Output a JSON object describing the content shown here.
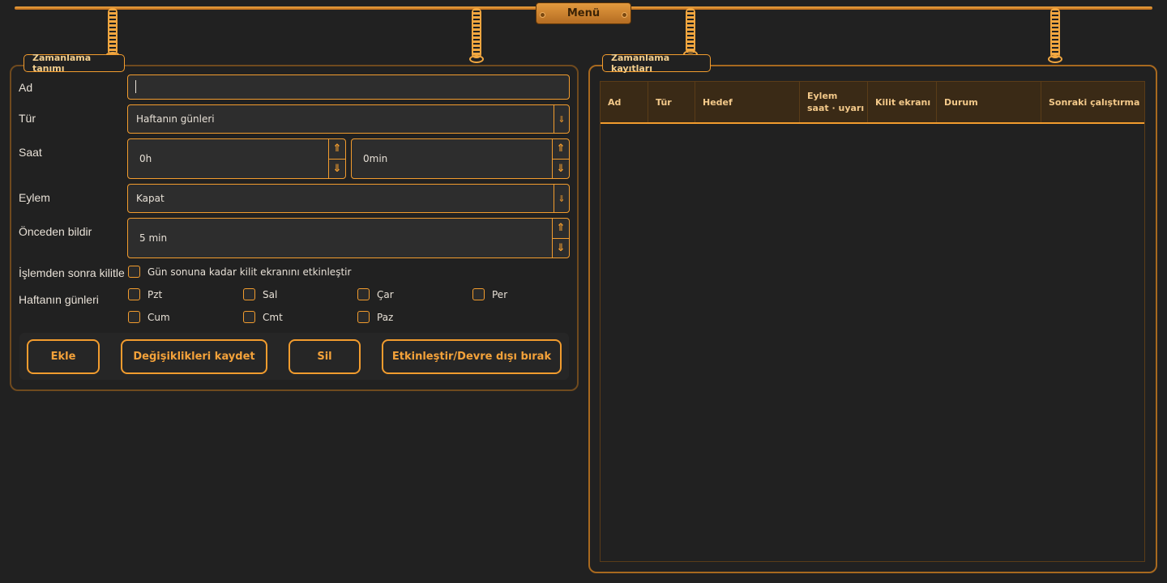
{
  "menu": {
    "label": "Menü"
  },
  "definition": {
    "title": "Zamanlama tanımı",
    "name": {
      "label": "Ad",
      "value": ""
    },
    "type": {
      "label": "Tür",
      "value": "Haftanın günleri"
    },
    "time": {
      "label": "Saat",
      "hours": "0h",
      "minutes": "0min"
    },
    "action": {
      "label": "Eylem",
      "value": "Kapat"
    },
    "notify": {
      "label": "Önceden bildir",
      "value": "5 min"
    },
    "lock": {
      "label": "İşlemden sonra kilitle",
      "checkbox_label": "Gün sonuna kadar kilit ekranını etkinleştir",
      "checked": false
    },
    "weekdays": {
      "label": "Haftanın günleri",
      "days": [
        "Pzt",
        "Sal",
        "Çar",
        "Per",
        "Cum",
        "Cmt",
        "Paz"
      ]
    },
    "buttons": {
      "add": "Ekle",
      "save": "Değişiklikleri kaydet",
      "delete": "Sil",
      "toggle": "Etkinleştir/Devre dışı bırak"
    }
  },
  "records": {
    "title": "Zamanlama kayıtları",
    "columns": [
      "Ad",
      "Tür",
      "Hedef",
      "Eylem",
      "saat · uyarı",
      "Kilit ekranı",
      "Durum",
      "Sonraki çalıştırma"
    ],
    "rows": []
  },
  "icons": {
    "dropdown": "chevron-down-icon",
    "spin_up": "arrow-up-icon",
    "spin_down": "arrow-down-icon"
  },
  "colors": {
    "accent": "#f29c2e",
    "background": "#212121"
  }
}
